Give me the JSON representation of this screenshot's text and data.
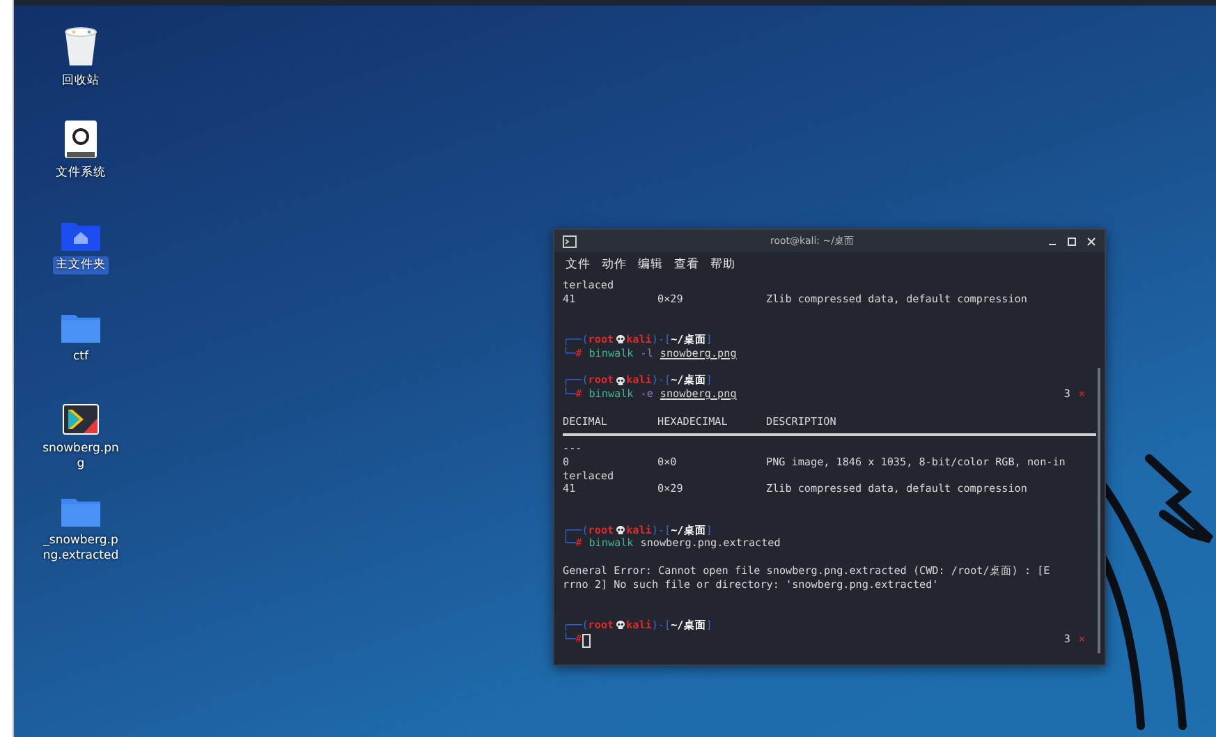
{
  "desktop_icons": [
    {
      "label": "回收站",
      "kind": "trash",
      "selected": false
    },
    {
      "label": "文件系统",
      "kind": "drive",
      "selected": false
    },
    {
      "label": "主文件夹",
      "kind": "home",
      "selected": true
    },
    {
      "label": "ctf",
      "kind": "folder",
      "selected": false
    },
    {
      "label": "snowberg.png",
      "kind": "image",
      "selected": false
    },
    {
      "label": "_snowberg.png.extracted",
      "kind": "folder",
      "selected": false
    }
  ],
  "terminal": {
    "title": "root@kali: ~/桌面",
    "menu": [
      "文件",
      "动作",
      "编辑",
      "查看",
      "帮助"
    ],
    "lines": [
      {
        "kind": "text",
        "text": "terlaced"
      },
      {
        "kind": "row",
        "cells": [
          "41",
          "0×29",
          "Zlib compressed data, default compression"
        ]
      },
      {
        "kind": "blank"
      },
      {
        "kind": "blank"
      },
      {
        "kind": "prompt_head",
        "open": "┌──(",
        "user": "root",
        "host": "kali",
        "middle": ")-[",
        "path": "~/桌面",
        "close": "]"
      },
      {
        "kind": "command",
        "frame": "└─",
        "hash": "#",
        "program": "binwalk",
        "option": "-l",
        "file": "snowberg.png"
      },
      {
        "kind": "blank"
      },
      {
        "kind": "prompt_head",
        "open": "┌──(",
        "user": "root",
        "host": "kali",
        "middle": ")-[",
        "path": "~/桌面",
        "close": "]"
      },
      {
        "kind": "command",
        "frame": "└─",
        "hash": "#",
        "program": "binwalk",
        "option": "-e",
        "file": "snowberg.png",
        "exit_code": "3",
        "error_mark": "×"
      },
      {
        "kind": "blank"
      },
      {
        "kind": "row",
        "cells": [
          "DECIMAL",
          "HEXADECIMAL",
          "DESCRIPTION"
        ]
      },
      {
        "kind": "rule"
      },
      {
        "kind": "text",
        "text": "---"
      },
      {
        "kind": "row",
        "cells": [
          "0",
          "0×0",
          "PNG image, 1846 x 1035, 8-bit/color RGB, non-in"
        ]
      },
      {
        "kind": "text",
        "text": "terlaced"
      },
      {
        "kind": "row",
        "cells": [
          "41",
          "0×29",
          "Zlib compressed data, default compression"
        ]
      },
      {
        "kind": "blank"
      },
      {
        "kind": "blank"
      },
      {
        "kind": "prompt_head",
        "open": "┌──(",
        "user": "root",
        "host": "kali",
        "middle": ")-[",
        "path": "~/桌面",
        "close": "]"
      },
      {
        "kind": "command",
        "frame": "└─",
        "hash": "#",
        "program": "binwalk",
        "argument": "snowberg.png.extracted"
      },
      {
        "kind": "blank"
      },
      {
        "kind": "text",
        "text": "General Error: Cannot open file snowberg.png.extracted (CWD: /root/桌面) : [E"
      },
      {
        "kind": "text",
        "text": "rrno 2] No such file or directory: 'snowberg.png.extracted'"
      },
      {
        "kind": "blank"
      },
      {
        "kind": "blank"
      },
      {
        "kind": "prompt_head",
        "open": "┌──(",
        "user": "root",
        "host": "kali",
        "middle": ")-[",
        "path": "~/桌面",
        "close": "]"
      },
      {
        "kind": "command",
        "frame": "└─",
        "hash": "#",
        "cursor": true,
        "exit_code": "3",
        "error_mark": "×"
      }
    ]
  }
}
